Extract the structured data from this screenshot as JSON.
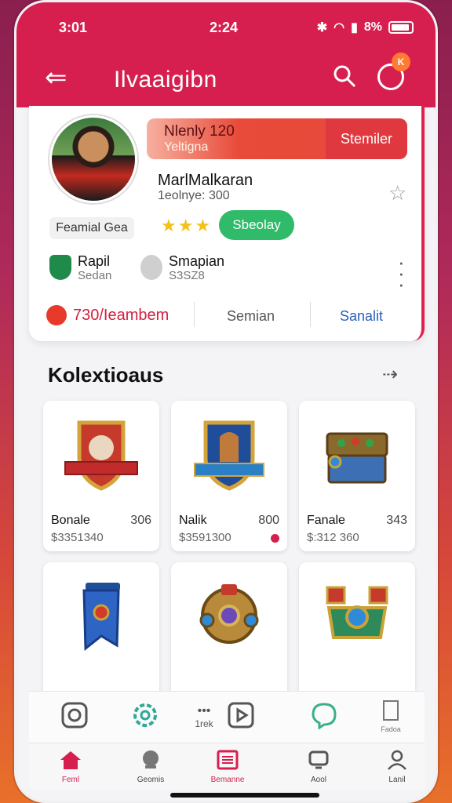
{
  "status_bar": {
    "time_left": "3:01",
    "time_center": "2:24",
    "battery_text": "8%"
  },
  "header": {
    "title": "Ilvaaigibn",
    "badge": "K"
  },
  "profile": {
    "promo_title": "Nlenly 120",
    "promo_subtitle": "Yeltigna",
    "promo_button": "Stemiler",
    "name": "MarlMalkaran",
    "subtitle": "1eolnye: 300",
    "tag": "Feamial Gea",
    "stars": "★★★",
    "action_button": "Sbeolay",
    "team1": {
      "name": "Rapil",
      "sub": "Sedan"
    },
    "team2": {
      "name": "Smapian",
      "sub": "S3SZ8"
    },
    "stat1": "730/Ieambem",
    "stat2": "Semian",
    "stat3": "Sanalit"
  },
  "collections": {
    "title": "Kolextioaus",
    "items": [
      {
        "name": "Bonale",
        "count": "306",
        "sub": "$3351340",
        "art": "crest-banner"
      },
      {
        "name": "Nalik",
        "count": "800",
        "sub": "$3591300",
        "art": "crest-dog",
        "dot": true
      },
      {
        "name": "Fanale",
        "count": "343",
        "sub": "$:312 360",
        "art": "chest"
      },
      {
        "name": "",
        "count": "",
        "sub": "",
        "art": "blue-banner"
      },
      {
        "name": "",
        "count": "",
        "sub": "",
        "art": "gold-shield"
      },
      {
        "name": "",
        "count": "",
        "sub": "",
        "art": "crown-gem"
      }
    ]
  },
  "bottom_tabs_row1": [
    {
      "icon": "camera-icon",
      "label": ""
    },
    {
      "icon": "gear-icon",
      "label": ""
    },
    {
      "icon": "more-icon",
      "label": "1rek"
    },
    {
      "icon": "play-icon",
      "label": ""
    },
    {
      "icon": "chat-icon",
      "label": ""
    },
    {
      "icon": "tag-icon",
      "label": "Fadoa"
    }
  ],
  "bottom_tabs_row2": [
    {
      "icon": "home-icon",
      "label": "Feml",
      "active": true
    },
    {
      "icon": "globe-icon",
      "label": "Geomis"
    },
    {
      "icon": "list-icon",
      "label": "Bemanne",
      "active": true
    },
    {
      "icon": "tv-icon",
      "label": "Aool"
    },
    {
      "icon": "user-icon",
      "label": "Lanil"
    }
  ],
  "colors": {
    "primary": "#d61f4f",
    "accent": "#2fbb6a",
    "star": "#f2c21b"
  }
}
